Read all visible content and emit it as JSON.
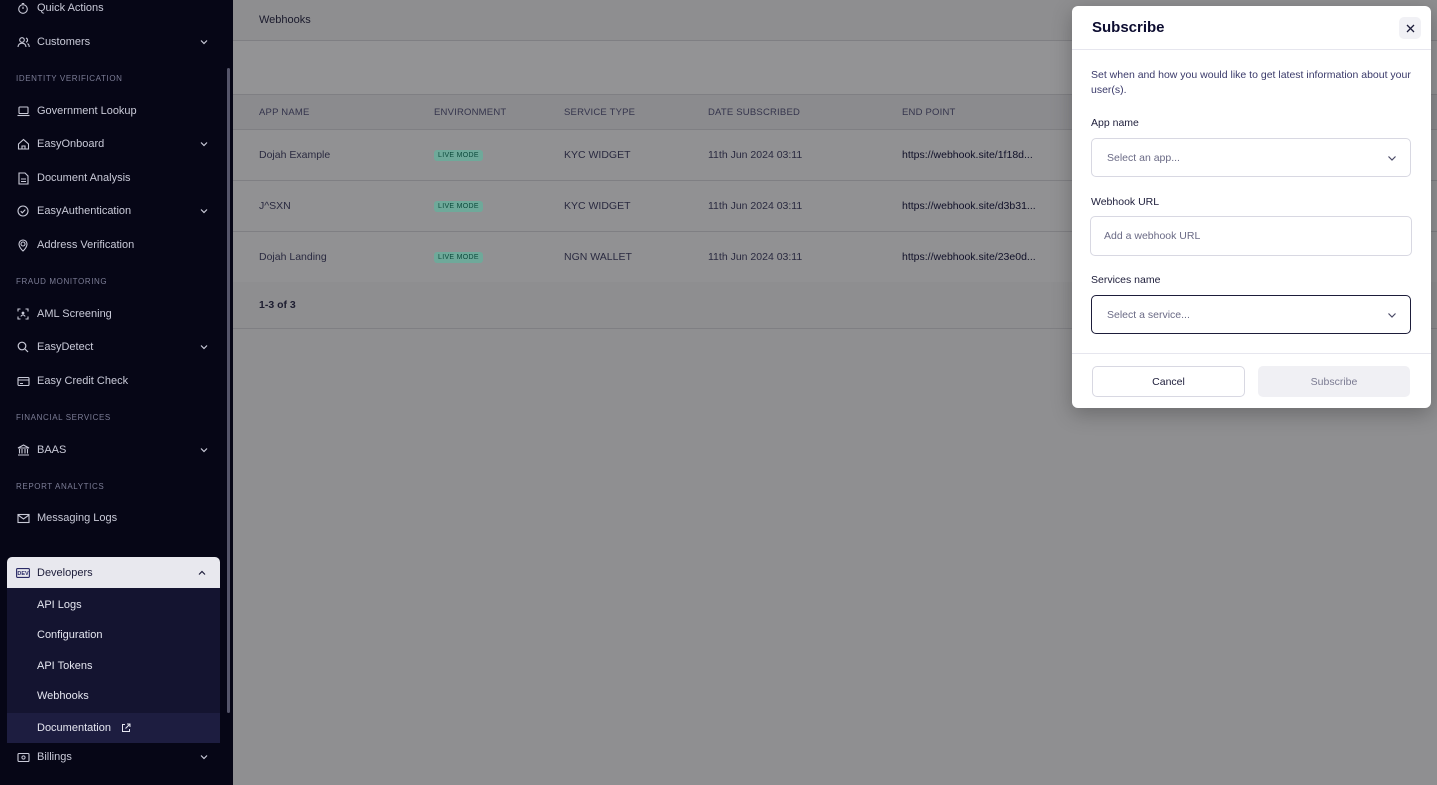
{
  "sidebar": {
    "items": [
      {
        "label": "Quick Actions",
        "icon": "stopwatch-icon"
      },
      {
        "label": "Customers",
        "icon": "users-icon"
      },
      {
        "label": "Government Lookup",
        "icon": "laptop-icon"
      },
      {
        "label": "EasyOnboard",
        "icon": "home-icon"
      },
      {
        "label": "Document Analysis",
        "icon": "document-icon"
      },
      {
        "label": "EasyAuthentication",
        "icon": "check-circle-icon"
      },
      {
        "label": "Address Verification",
        "icon": "map-pin-icon"
      },
      {
        "label": "AML Screening",
        "icon": "scan-face-icon"
      },
      {
        "label": "EasyDetect",
        "icon": "search-icon"
      },
      {
        "label": "Easy Credit Check",
        "icon": "credit-card-icon"
      },
      {
        "label": "BAAS",
        "icon": "bank-icon"
      },
      {
        "label": "Messaging Logs",
        "icon": "mail-icon"
      },
      {
        "label": "Billings",
        "icon": "bill-icon"
      }
    ],
    "sections": {
      "identity": "IDENTITY VERIFICATION",
      "fraud": "FRAUD MONITORING",
      "financial": "FINANCIAL SERVICES",
      "report": "REPORT ANALYTICS"
    },
    "developers": {
      "label": "Developers",
      "icon": "dev-icon",
      "sub": [
        "API Logs",
        "Configuration",
        "API Tokens",
        "Webhooks",
        "Documentation"
      ]
    }
  },
  "header": {
    "title": "Webhooks"
  },
  "table": {
    "columns": [
      "APP NAME",
      "ENVIRONMENT",
      "SERVICE TYPE",
      "DATE SUBSCRIBED",
      "END POINT"
    ],
    "rows": [
      {
        "app": "Dojah Example",
        "env": "LIVE MODE",
        "service": "KYC WIDGET",
        "date": "11th Jun 2024 03:11",
        "endpoint": "https://webhook.site/1f18d..."
      },
      {
        "app": "J^SXN",
        "env": "LIVE MODE",
        "service": "KYC WIDGET",
        "date": "11th Jun 2024 03:11",
        "endpoint": "https://webhook.site/d3b31..."
      },
      {
        "app": "Dojah Landing",
        "env": "LIVE MODE",
        "service": "NGN WALLET",
        "date": "11th Jun 2024 03:11",
        "endpoint": "https://webhook.site/23e0d..."
      }
    ],
    "pagination": "1-3 of 3"
  },
  "modal": {
    "title": "Subscribe",
    "description": "Set when and how you would like to get latest information about your user(s).",
    "app_label": "App name",
    "app_placeholder": "Select an app...",
    "url_label": "Webhook URL",
    "url_placeholder": "Add a webhook URL",
    "service_label": "Services name",
    "service_placeholder": "Select a service...",
    "cancel": "Cancel",
    "subscribe": "Subscribe"
  }
}
